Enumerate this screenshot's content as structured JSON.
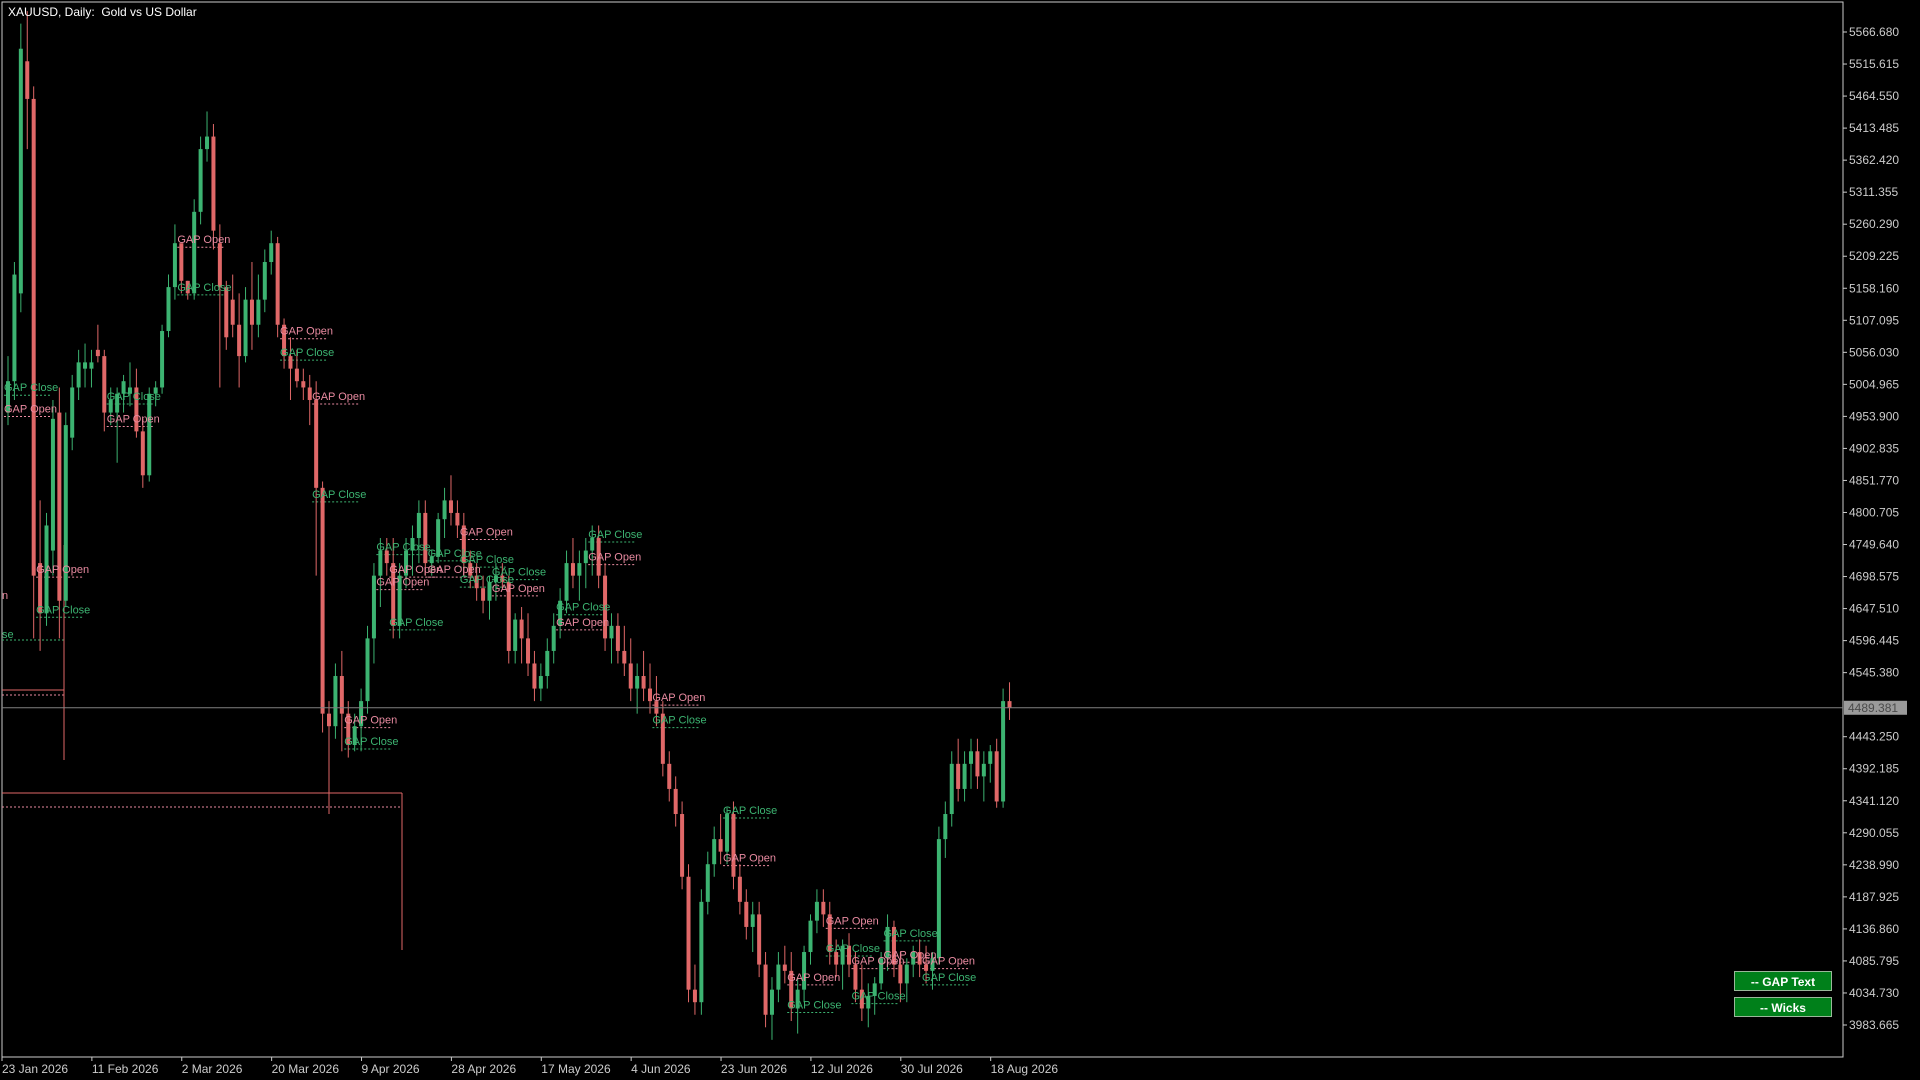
{
  "window": {
    "title": "XAUUSD, Daily:  Gold vs US Dollar"
  },
  "controls": {
    "gap_text_label": "-- GAP Text",
    "wicks_label": "-- Wicks"
  },
  "colors": {
    "background": "#000000",
    "bull": "#3cb371",
    "bear": "#e06868",
    "gap_open_text": "#e88aa0",
    "gap_close_text": "#3cb371",
    "axis": "#cccccc",
    "price_line": "#808080",
    "button_bg": "#00801a"
  },
  "chart_data": {
    "type": "candlestick",
    "symbol": "XAUUSD",
    "timeframe": "Daily",
    "ylim": [
      3950,
      5620
    ],
    "y_ticks": [
      "5566.680",
      "5515.615",
      "5464.550",
      "5413.485",
      "5362.420",
      "5311.355",
      "5260.290",
      "5209.225",
      "5158.160",
      "5107.095",
      "5056.030",
      "5004.965",
      "4953.900",
      "4902.835",
      "4851.770",
      "4800.705",
      "4749.640",
      "4698.575",
      "4647.510",
      "4596.445",
      "4545.380",
      "4443.250",
      "4392.185",
      "4341.120",
      "4290.055",
      "4238.990",
      "4187.925",
      "4136.860",
      "4085.795",
      "4034.730",
      "3983.665"
    ],
    "current_price": "4489.381",
    "x_labels": [
      "23 Jan 2026",
      "11 Feb 2026",
      "2 Mar 2026",
      "20 Mar 2026",
      "9 Apr 2026",
      "28 Apr 2026",
      "17 May 2026",
      "4 Jun 2026",
      "23 Jun 2026",
      "12 Jul 2026",
      "30 Jul 2026",
      "18 Aug 2026"
    ],
    "x_label_index": [
      0,
      14,
      28,
      42,
      56,
      70,
      84,
      98,
      112,
      126,
      140,
      154
    ],
    "candles": [
      [
        4960,
        5050,
        4940,
        5010
      ],
      [
        5010,
        5200,
        4980,
        5180
      ],
      [
        5150,
        5580,
        5120,
        5540
      ],
      [
        5520,
        5600,
        5380,
        5460
      ],
      [
        5460,
        5480,
        4600,
        4700
      ],
      [
        4720,
        4820,
        4580,
        4640
      ],
      [
        4640,
        4800,
        4620,
        4780
      ],
      [
        4740,
        4980,
        4700,
        4950
      ],
      [
        4960,
        5000,
        4600,
        4660
      ],
      [
        4660,
        4960,
        4650,
        4940
      ],
      [
        4920,
        5020,
        4900,
        5000
      ],
      [
        5000,
        5060,
        4980,
        5040
      ],
      [
        5030,
        5070,
        5000,
        5040
      ],
      [
        5030,
        5060,
        5000,
        5040
      ],
      [
        5060,
        5100,
        5040,
        5050
      ],
      [
        5050,
        5060,
        4930,
        4960
      ],
      [
        4960,
        5000,
        4940,
        4980
      ],
      [
        4960,
        5000,
        4880,
        4990
      ],
      [
        4990,
        5020,
        4960,
        5010
      ],
      [
        4990,
        5040,
        4970,
        5000
      ],
      [
        5000,
        5030,
        4920,
        4930
      ],
      [
        4930,
        4950,
        4840,
        4860
      ],
      [
        4860,
        5000,
        4850,
        4990
      ],
      [
        4990,
        5010,
        4970,
        5000
      ],
      [
        5000,
        5100,
        4990,
        5090
      ],
      [
        5090,
        5180,
        5080,
        5160
      ],
      [
        5160,
        5260,
        5140,
        5230
      ],
      [
        5230,
        5200,
        5150,
        5170
      ],
      [
        5170,
        5170,
        5140,
        5150
      ],
      [
        5150,
        5300,
        5140,
        5280
      ],
      [
        5280,
        5400,
        5260,
        5380
      ],
      [
        5380,
        5440,
        5360,
        5400
      ],
      [
        5400,
        5420,
        5220,
        5250
      ],
      [
        5230,
        5260,
        5000,
        5160
      ],
      [
        5160,
        5170,
        5060,
        5080
      ],
      [
        5140,
        5180,
        5080,
        5100
      ],
      [
        5100,
        5150,
        5000,
        5050
      ],
      [
        5050,
        5160,
        5040,
        5140
      ],
      [
        5140,
        5200,
        5060,
        5100
      ],
      [
        5100,
        5180,
        5080,
        5140
      ],
      [
        5140,
        5220,
        5120,
        5200
      ],
      [
        5200,
        5250,
        5180,
        5230
      ],
      [
        5230,
        5240,
        5080,
        5100
      ],
      [
        5100,
        5110,
        5030,
        5050
      ],
      [
        5050,
        5080,
        4980,
        5030
      ],
      [
        5030,
        5060,
        5000,
        5010
      ],
      [
        5010,
        5030,
        4980,
        5000
      ],
      [
        5000,
        5020,
        4940,
        4980
      ],
      [
        4980,
        5010,
        4700,
        4840
      ],
      [
        4840,
        4850,
        4450,
        4480
      ],
      [
        4480,
        4500,
        4320,
        4460
      ],
      [
        4460,
        4560,
        4440,
        4540
      ],
      [
        4540,
        4580,
        4420,
        4480
      ],
      [
        4480,
        4500,
        4410,
        4430
      ],
      [
        4430,
        4480,
        4420,
        4460
      ],
      [
        4460,
        4520,
        4420,
        4500
      ],
      [
        4500,
        4620,
        4480,
        4600
      ],
      [
        4600,
        4720,
        4560,
        4700
      ],
      [
        4700,
        4760,
        4650,
        4740
      ],
      [
        4740,
        4760,
        4700,
        4720
      ],
      [
        4720,
        4760,
        4600,
        4620
      ],
      [
        4620,
        4720,
        4600,
        4700
      ],
      [
        4700,
        4760,
        4680,
        4740
      ],
      [
        4740,
        4780,
        4700,
        4760
      ],
      [
        4760,
        4820,
        4720,
        4800
      ],
      [
        4800,
        4820,
        4700,
        4720
      ],
      [
        4720,
        4740,
        4700,
        4730
      ],
      [
        4730,
        4800,
        4720,
        4790
      ],
      [
        4790,
        4840,
        4760,
        4820
      ],
      [
        4820,
        4860,
        4780,
        4800
      ],
      [
        4800,
        4820,
        4760,
        4780
      ],
      [
        4780,
        4800,
        4700,
        4720
      ],
      [
        4720,
        4740,
        4680,
        4700
      ],
      [
        4700,
        4720,
        4660,
        4680
      ],
      [
        4680,
        4700,
        4640,
        4660
      ],
      [
        4660,
        4700,
        4630,
        4690
      ],
      [
        4690,
        4720,
        4660,
        4700
      ],
      [
        4700,
        4720,
        4680,
        4690
      ],
      [
        4690,
        4700,
        4560,
        4580
      ],
      [
        4580,
        4640,
        4560,
        4630
      ],
      [
        4630,
        4650,
        4560,
        4600
      ],
      [
        4600,
        4640,
        4540,
        4560
      ],
      [
        4560,
        4580,
        4500,
        4520
      ],
      [
        4520,
        4560,
        4500,
        4540
      ],
      [
        4540,
        4600,
        4520,
        4580
      ],
      [
        4580,
        4640,
        4560,
        4620
      ],
      [
        4620,
        4680,
        4600,
        4660
      ],
      [
        4660,
        4740,
        4640,
        4720
      ],
      [
        4720,
        4760,
        4680,
        4700
      ],
      [
        4700,
        4740,
        4660,
        4720
      ],
      [
        4720,
        4760,
        4680,
        4740
      ],
      [
        4740,
        4780,
        4700,
        4760
      ],
      [
        4760,
        4780,
        4680,
        4700
      ],
      [
        4700,
        4720,
        4580,
        4600
      ],
      [
        4600,
        4640,
        4560,
        4620
      ],
      [
        4620,
        4640,
        4560,
        4580
      ],
      [
        4580,
        4620,
        4540,
        4560
      ],
      [
        4560,
        4600,
        4500,
        4520
      ],
      [
        4520,
        4560,
        4480,
        4540
      ],
      [
        4540,
        4580,
        4500,
        4520
      ],
      [
        4520,
        4560,
        4480,
        4500
      ],
      [
        4500,
        4540,
        4460,
        4480
      ],
      [
        4480,
        4500,
        4380,
        4400
      ],
      [
        4400,
        4420,
        4340,
        4360
      ],
      [
        4360,
        4380,
        4300,
        4320
      ],
      [
        4320,
        4340,
        4200,
        4220
      ],
      [
        4220,
        4240,
        4020,
        4040
      ],
      [
        4040,
        4080,
        4000,
        4020
      ],
      [
        4020,
        4200,
        4000,
        4180
      ],
      [
        4180,
        4260,
        4160,
        4240
      ],
      [
        4240,
        4300,
        4220,
        4280
      ],
      [
        4280,
        4320,
        4240,
        4260
      ],
      [
        4260,
        4330,
        4240,
        4320
      ],
      [
        4320,
        4340,
        4200,
        4220
      ],
      [
        4220,
        4240,
        4160,
        4180
      ],
      [
        4180,
        4200,
        4120,
        4140
      ],
      [
        4140,
        4180,
        4100,
        4160
      ],
      [
        4160,
        4180,
        4060,
        4080
      ],
      [
        4080,
        4100,
        3980,
        4000
      ],
      [
        4000,
        4060,
        3960,
        4040
      ],
      [
        4040,
        4100,
        4020,
        4080
      ],
      [
        4080,
        4110,
        4050,
        4070
      ],
      [
        4070,
        4100,
        3990,
        4010
      ],
      [
        4010,
        4060,
        3970,
        4040
      ],
      [
        4040,
        4110,
        4020,
        4100
      ],
      [
        4100,
        4160,
        4080,
        4150
      ],
      [
        4150,
        4200,
        4130,
        4180
      ],
      [
        4180,
        4200,
        4140,
        4160
      ],
      [
        4160,
        4180,
        4080,
        4100
      ],
      [
        4100,
        4120,
        4060,
        4080
      ],
      [
        4080,
        4120,
        4040,
        4110
      ],
      [
        4110,
        4130,
        4060,
        4080
      ],
      [
        4080,
        4100,
        4020,
        4040
      ],
      [
        4040,
        4080,
        3990,
        4010
      ],
      [
        4010,
        4050,
        3980,
        4030
      ],
      [
        4030,
        4060,
        4000,
        4050
      ],
      [
        4050,
        4100,
        4040,
        4090
      ],
      [
        4090,
        4160,
        4070,
        4140
      ],
      [
        4140,
        4150,
        4060,
        4080
      ],
      [
        4080,
        4100,
        4020,
        4050
      ],
      [
        4050,
        4090,
        4020,
        4080
      ],
      [
        4080,
        4110,
        4060,
        4100
      ],
      [
        4100,
        4120,
        4060,
        4080
      ],
      [
        4080,
        4110,
        4050,
        4070
      ],
      [
        4070,
        4100,
        4040,
        4090
      ],
      [
        4090,
        4300,
        4080,
        4280
      ],
      [
        4280,
        4340,
        4250,
        4320
      ],
      [
        4320,
        4420,
        4300,
        4400
      ],
      [
        4400,
        4440,
        4340,
        4360
      ],
      [
        4360,
        4420,
        4340,
        4400
      ],
      [
        4400,
        4440,
        4360,
        4420
      ],
      [
        4420,
        4440,
        4360,
        4380
      ],
      [
        4380,
        4420,
        4340,
        4400
      ],
      [
        4400,
        4430,
        4370,
        4420
      ],
      [
        4420,
        4440,
        4330,
        4340
      ],
      [
        4340,
        4520,
        4330,
        4500
      ],
      [
        4500,
        4530,
        4470,
        4489
      ]
    ],
    "gap_labels": [
      {
        "i": 0,
        "text": "GAP Open",
        "kind": "open"
      },
      {
        "i": 0,
        "text": "GAP Close",
        "kind": "close"
      },
      {
        "i": 5,
        "text": "GAP Close",
        "kind": "close"
      },
      {
        "i": 5,
        "text": "GAP Open",
        "kind": "open"
      },
      {
        "i": 16,
        "text": "GAP Close",
        "kind": "close"
      },
      {
        "i": 16,
        "text": "GAP Open",
        "kind": "open"
      },
      {
        "i": 27,
        "text": "GAP Open",
        "kind": "open"
      },
      {
        "i": 27,
        "text": "GAP Close",
        "kind": "close"
      },
      {
        "i": 43,
        "text": "GAP Close",
        "kind": "close"
      },
      {
        "i": 43,
        "text": "GAP Open",
        "kind": "open"
      },
      {
        "i": 48,
        "text": "GAP Open",
        "kind": "open"
      },
      {
        "i": 48,
        "text": "GAP Close",
        "kind": "close"
      },
      {
        "i": 53,
        "text": "GAP Close",
        "kind": "close"
      },
      {
        "i": 53,
        "text": "GAP Open",
        "kind": "open"
      },
      {
        "i": 58,
        "text": "GAP Close",
        "kind": "close"
      },
      {
        "i": 58,
        "text": "GAP Open",
        "kind": "open"
      },
      {
        "i": 60,
        "text": "GAP Close",
        "kind": "close"
      },
      {
        "i": 60,
        "text": "GAP Open",
        "kind": "open"
      },
      {
        "i": 66,
        "text": "GAP Close",
        "kind": "close"
      },
      {
        "i": 66,
        "text": "GAP Open",
        "kind": "open"
      },
      {
        "i": 71,
        "text": "GAP Close",
        "kind": "close"
      },
      {
        "i": 71,
        "text": "GAP Open",
        "kind": "open"
      },
      {
        "i": 71,
        "text": "GAP Close",
        "kind": "close"
      },
      {
        "i": 76,
        "text": "GAP Close",
        "kind": "close"
      },
      {
        "i": 76,
        "text": "GAP Open",
        "kind": "open"
      },
      {
        "i": 86,
        "text": "GAP Open",
        "kind": "open"
      },
      {
        "i": 86,
        "text": "GAP Close",
        "kind": "close"
      },
      {
        "i": 91,
        "text": "GAP Close",
        "kind": "close"
      },
      {
        "i": 91,
        "text": "GAP Open",
        "kind": "open"
      },
      {
        "i": 101,
        "text": "GAP Open",
        "kind": "open"
      },
      {
        "i": 101,
        "text": "GAP Close",
        "kind": "close"
      },
      {
        "i": 112,
        "text": "GAP Close",
        "kind": "close"
      },
      {
        "i": 112,
        "text": "GAP Open",
        "kind": "open"
      },
      {
        "i": 122,
        "text": "GAP Close",
        "kind": "close"
      },
      {
        "i": 122,
        "text": "GAP Open",
        "kind": "open"
      },
      {
        "i": 128,
        "text": "GAP Close",
        "kind": "close"
      },
      {
        "i": 128,
        "text": "GAP Open",
        "kind": "open"
      },
      {
        "i": 132,
        "text": "GAP Open",
        "kind": "open"
      },
      {
        "i": 132,
        "text": "GAP Close",
        "kind": "close"
      },
      {
        "i": 137,
        "text": "GAP Open",
        "kind": "open"
      },
      {
        "i": 137,
        "text": "GAP Close",
        "kind": "close"
      },
      {
        "i": 143,
        "text": "GAP Open",
        "kind": "open"
      },
      {
        "i": 143,
        "text": "GAP Close",
        "kind": "close"
      }
    ],
    "cut_labels": [
      {
        "text": "n",
        "kind": "open"
      },
      {
        "text": "se",
        "kind": "close"
      }
    ]
  }
}
